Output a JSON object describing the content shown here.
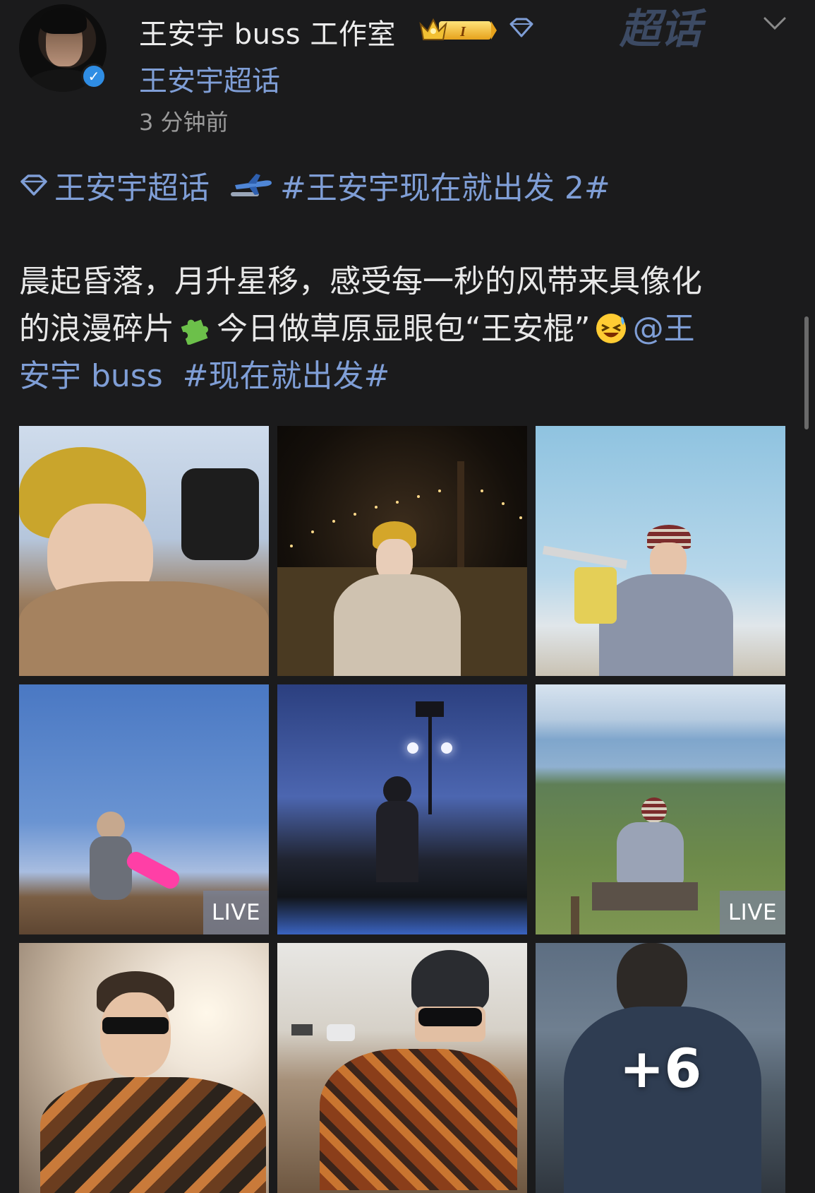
{
  "post": {
    "author": "王安宇 buss 工作室",
    "badge_level": "I",
    "source": "王安宇超话",
    "timestamp": "3 分钟前",
    "watermark": "超话",
    "tag_supertopic": "王安宇超话",
    "tag_topic": "#王安宇现在就出发 2#",
    "text_line1": "晨起昏落，月升星移，感受每一秒的风带来具像化",
    "text_line2_a": "的浪漫碎片",
    "text_line2_b": "今日做草原显眼包“王安棍”",
    "mention_a": "@王",
    "mention_b": "安宇 buss",
    "hashtag": "#现在就出发#"
  },
  "icons": {
    "verified": "verified-badge-icon",
    "crown": "crown-badge-icon",
    "diamond": "diamond-icon",
    "chevron": "chevron-down-icon",
    "plane": "airplane-icon",
    "puzzle": "puzzle-emoji",
    "laugh": "laughing-emoji"
  },
  "photos": {
    "live_label": "LIVE",
    "more_count": "+6",
    "tiles": [
      {
        "name": "photo-yellow-beanie-camera",
        "live": false
      },
      {
        "name": "photo-night-lights-headphones",
        "live": false
      },
      {
        "name": "photo-crossbow-sky",
        "live": false
      },
      {
        "name": "photo-pink-bat-live",
        "live": true
      },
      {
        "name": "photo-streetlamp-dusk",
        "live": false
      },
      {
        "name": "photo-grassland-sitting-live",
        "live": true
      },
      {
        "name": "photo-sunglasses-sunlight",
        "live": false
      },
      {
        "name": "photo-helmet-atv",
        "live": false
      },
      {
        "name": "photo-puffer-jacket-more",
        "live": false
      }
    ]
  },
  "colors": {
    "background": "#1b1b1c",
    "link": "#7f9ed6",
    "text": "#e8e8e8",
    "muted": "#9a9a9a"
  }
}
